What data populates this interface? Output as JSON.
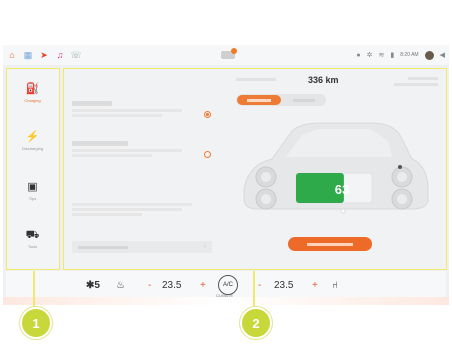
{
  "status_bar": {
    "time": "8:20 AM"
  },
  "sidebar": {
    "items": [
      {
        "label": "Charging",
        "icon": "fuel-pump-icon",
        "active": true
      },
      {
        "label": "Discharging",
        "icon": "lightning-icon",
        "active": false
      },
      {
        "label": "Tips",
        "icon": "tips-icon",
        "active": false
      },
      {
        "label": "Tools",
        "icon": "car-seat-icon",
        "active": false
      }
    ]
  },
  "charging": {
    "range": "336 km",
    "battery_percent": "63",
    "battery_level": 0.63
  },
  "climate": {
    "fan_left": "5",
    "temp_left": "23.5",
    "temp_right": "23.5",
    "minus": "-",
    "plus": "+",
    "label": "CLIMATE",
    "ac_label": "A/C"
  },
  "callouts": [
    "1",
    "2"
  ],
  "colors": {
    "accent": "#ee7b35",
    "highlight_border": "#f2e96a",
    "callout": "#c8d83a",
    "battery_green": "#2eaa4a"
  }
}
